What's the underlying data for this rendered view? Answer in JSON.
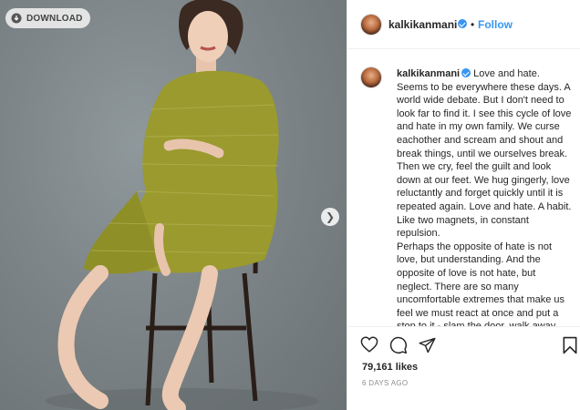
{
  "photo": {
    "download_label": "DOWNLOAD",
    "next_icon": "chevron-right-icon",
    "background_color": "#7d8588",
    "dress_color": "#9a9a2e"
  },
  "header": {
    "username": "kalkikanmani",
    "separator": "•",
    "follow_label": "Follow"
  },
  "post": {
    "username": "kalkikanmani",
    "caption": "Love and hate. Seems to be everywhere these days. A world wide debate. But I don't need to look far to find it. I see this cycle of love and hate in my own family. We curse eachother and scream and shout and break things, until we ourselves break. Then we cry, feel the guilt and look down at our feet. We hug gingerly, love reluctantly and forget quickly until it is repeated again. Love and hate. A habit. Like two magnets, in constant repulsion.\nPerhaps the opposite of hate is not love, but understanding. And the opposite of love is not hate, but neglect. There are so many uncomfortable extremes that make us feel we must react at once and put a stop to it - slam the door, walk away"
  },
  "actions": {
    "likes": "79,161 likes",
    "time": "6 DAYS AGO",
    "icons": [
      "heart-icon",
      "comment-icon",
      "share-icon",
      "bookmark-icon"
    ]
  },
  "colors": {
    "accent": "#3897f0",
    "text": "#262626",
    "muted": "#8e8e8e",
    "border": "#efefef"
  }
}
